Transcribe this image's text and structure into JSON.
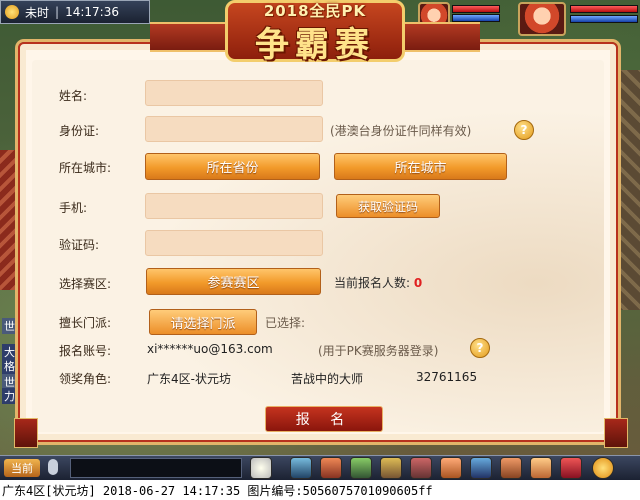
{
  "status": {
    "time_period": "未时",
    "clock": "14:17:36"
  },
  "banner": {
    "top_text": "2018全民PK",
    "main_text": "争霸赛"
  },
  "form": {
    "name_label": "姓名:",
    "id_label": "身份证:",
    "id_note": "(港澳台身份证件同样有效)",
    "city_label": "所在城市:",
    "province_button": "所在省份",
    "city_button": "所在城市",
    "phone_label": "手机:",
    "get_code_button": "获取验证码",
    "code_label": "验证码:",
    "zone_label": "选择赛区:",
    "zone_button": "参赛赛区",
    "count_label": "当前报名人数:",
    "count_value": "0",
    "sect_label": "擅长门派:",
    "sect_button": "请选择门派",
    "sect_selected_label": "已选择:",
    "account_label": "报名账号:",
    "account_value": "xi******uo@163.com",
    "account_note": "(用于PK赛服务器登录)",
    "role_label": "领奖角色:",
    "role_server": "广东4区-状元坊",
    "role_name": "苦战中的大师",
    "role_id": "32761165",
    "submit_button": "报 名",
    "help_glyph": "?"
  },
  "toolbar": {
    "chat_tab": "当前"
  },
  "side": {
    "tag1": "世界",
    "tag2": "世界",
    "tag3": "大龙",
    "tag4": "格德",
    "tag5": "力刀"
  },
  "caption": {
    "text": "广东4区[状元坊] 2018-06-27 14:17:35 图片编号:5056075701090605ff"
  }
}
